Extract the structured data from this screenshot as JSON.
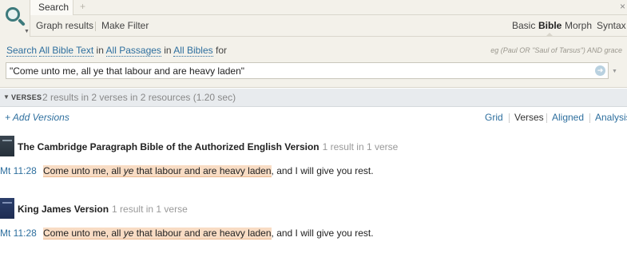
{
  "header": {
    "tab_label": "Search",
    "tab_add": "+",
    "close": "×",
    "toolbar": {
      "graph": "Graph results",
      "filter": "Make Filter"
    },
    "modes": [
      "Basic",
      "Bible",
      "Morph",
      "Syntax"
    ],
    "active_mode": "Bible"
  },
  "search": {
    "scope": {
      "p1": "Search",
      "link1": "All Bible Text",
      "p2": "in",
      "link2": "All Passages",
      "p3": "in",
      "link3": "All Bibles",
      "p4": "for"
    },
    "example_hint": "eg (Paul OR \"Saul of Tarsus\") AND grace",
    "query": "\"Come unto me, all ye that labour and are heavy laden\""
  },
  "results": {
    "section_label": "VERSES",
    "summary": "2 results in 2 verses in 2 resources (1.20 sec)",
    "add_versions": "+ Add Versions",
    "views": [
      "Grid",
      "Verses",
      "Aligned",
      "Analysis"
    ],
    "active_view": "Verses",
    "resources": [
      {
        "title": "The Cambridge Paragraph Bible of the Authorized English Version",
        "count": "1 result in 1 verse",
        "reference": "Mt 11:28",
        "hl_a": "Come unto me, all ",
        "hl_b": "ye",
        "hl_c": " that labour and are heavy laden",
        "rest": ", and I will give you rest."
      },
      {
        "title": "King James Version",
        "count": "1 result in 1 verse",
        "reference": "Mt 11:28",
        "hl_a": "Come unto me, all ",
        "hl_b": "ye",
        "hl_c": " that labour and are heavy laden",
        "rest": ", and I will give you rest."
      }
    ]
  },
  "colors": {
    "link": "#2e6f9e",
    "highlight": "#f8dcc4",
    "panel": "#f3f1ea"
  },
  "icons": {
    "logo": "search-magnifier-icon",
    "go": "go-arrow-icon"
  }
}
